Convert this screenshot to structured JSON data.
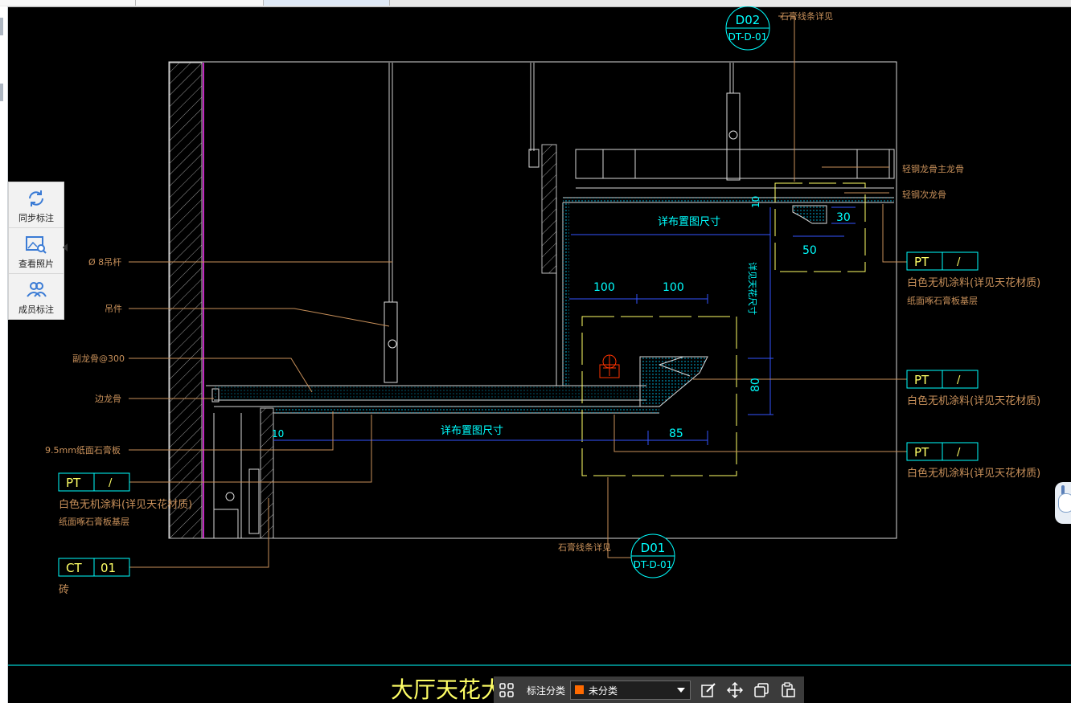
{
  "app": {
    "side_panel": {
      "items": [
        {
          "label": "同步标注",
          "icon": "sync-icon"
        },
        {
          "label": "查看照片",
          "icon": "photo-icon"
        },
        {
          "label": "成员标注",
          "icon": "members-icon"
        }
      ]
    },
    "annotation_bar": {
      "label": "标注分类",
      "selected": "未分类",
      "selected_color": "#ff6a00",
      "tools": [
        "edit-icon",
        "move-icon",
        "copy-icon",
        "paste-icon"
      ]
    }
  },
  "drawing": {
    "title": "大厅天花大样",
    "callouts": {
      "d02": {
        "top": "D02",
        "bottom": "DT-D-01",
        "note": "石膏线条详见"
      },
      "d01": {
        "top": "D01",
        "bottom": "DT-D-01",
        "note": "石膏线条详见"
      }
    },
    "leaders": {
      "rod": "Ø 8吊杆",
      "hanger": "吊件",
      "secondary": "副龙骨@300",
      "edge": "边龙骨",
      "board": "9.5mm纸面石膏板",
      "main_keel": "轻钢龙骨主龙骨",
      "secondary_keel": "轻钢次龙骨"
    },
    "dims": {
      "d10a": "10",
      "d30": "30",
      "d50": "50",
      "d100a": "100",
      "d100b": "100",
      "d80": "80",
      "d85": "85",
      "d10b": "10",
      "span_upper": "详布置图尺寸",
      "span_lower": "详布置图尺寸",
      "vertical": "详见天花尺寸"
    },
    "tags": {
      "pt1": {
        "code": "PT",
        "num": "/",
        "desc": "白色无机涂料(详见天花材质)",
        "sub": "纸面啄石膏板基层"
      },
      "pt2": {
        "code": "PT",
        "num": "/",
        "desc": "白色无机涂料(详见天花材质)"
      },
      "pt3": {
        "code": "PT",
        "num": "/",
        "desc": "白色无机涂料(详见天花材质)"
      },
      "pt4": {
        "code": "PT",
        "num": "/",
        "desc": "白色无机涂料(详见天花材质)",
        "sub": "纸面啄石膏板基层"
      },
      "ct": {
        "code": "CT",
        "num": "01",
        "desc": "砖"
      }
    },
    "colors": {
      "line": "#d8d8d8",
      "cyan": "#00ffff",
      "yellow": "#ffff66",
      "blue": "#3355ff",
      "leader": "#c8905a",
      "magenta": "#ff33ff",
      "red": "#ff3300"
    }
  }
}
